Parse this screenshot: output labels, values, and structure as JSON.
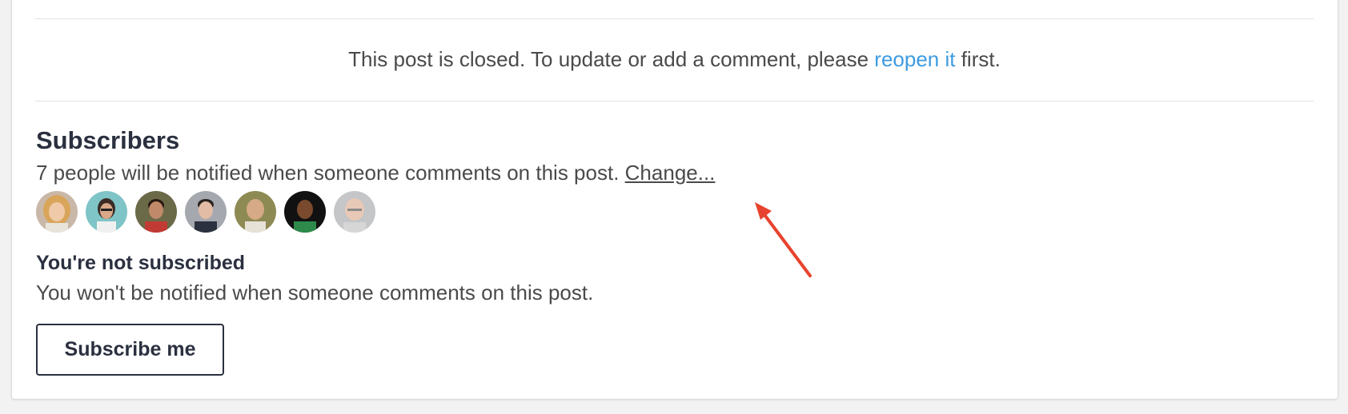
{
  "closed_notice": {
    "before": "This post is closed. To update or add a comment, please ",
    "link": "reopen it",
    "after": " first."
  },
  "subscribers": {
    "title": "Subscribers",
    "description": "7 people will be notified when someone comments on this post. ",
    "change_link": "Change...",
    "avatars": [
      {
        "name": "subscriber-avatar-1"
      },
      {
        "name": "subscriber-avatar-2"
      },
      {
        "name": "subscriber-avatar-3"
      },
      {
        "name": "subscriber-avatar-4"
      },
      {
        "name": "subscriber-avatar-5"
      },
      {
        "name": "subscriber-avatar-6"
      },
      {
        "name": "subscriber-avatar-7"
      }
    ]
  },
  "subscription_status": {
    "title": "You're not subscribed",
    "description": "You won't be notified when someone comments on this post.",
    "button_label": "Subscribe me"
  },
  "annotation": {
    "arrow_color": "#e8432e",
    "icon": "arrow-pointer-icon"
  },
  "colors": {
    "link": "#3d9be0",
    "heading": "#2b3040",
    "text": "#4a4a4a"
  }
}
